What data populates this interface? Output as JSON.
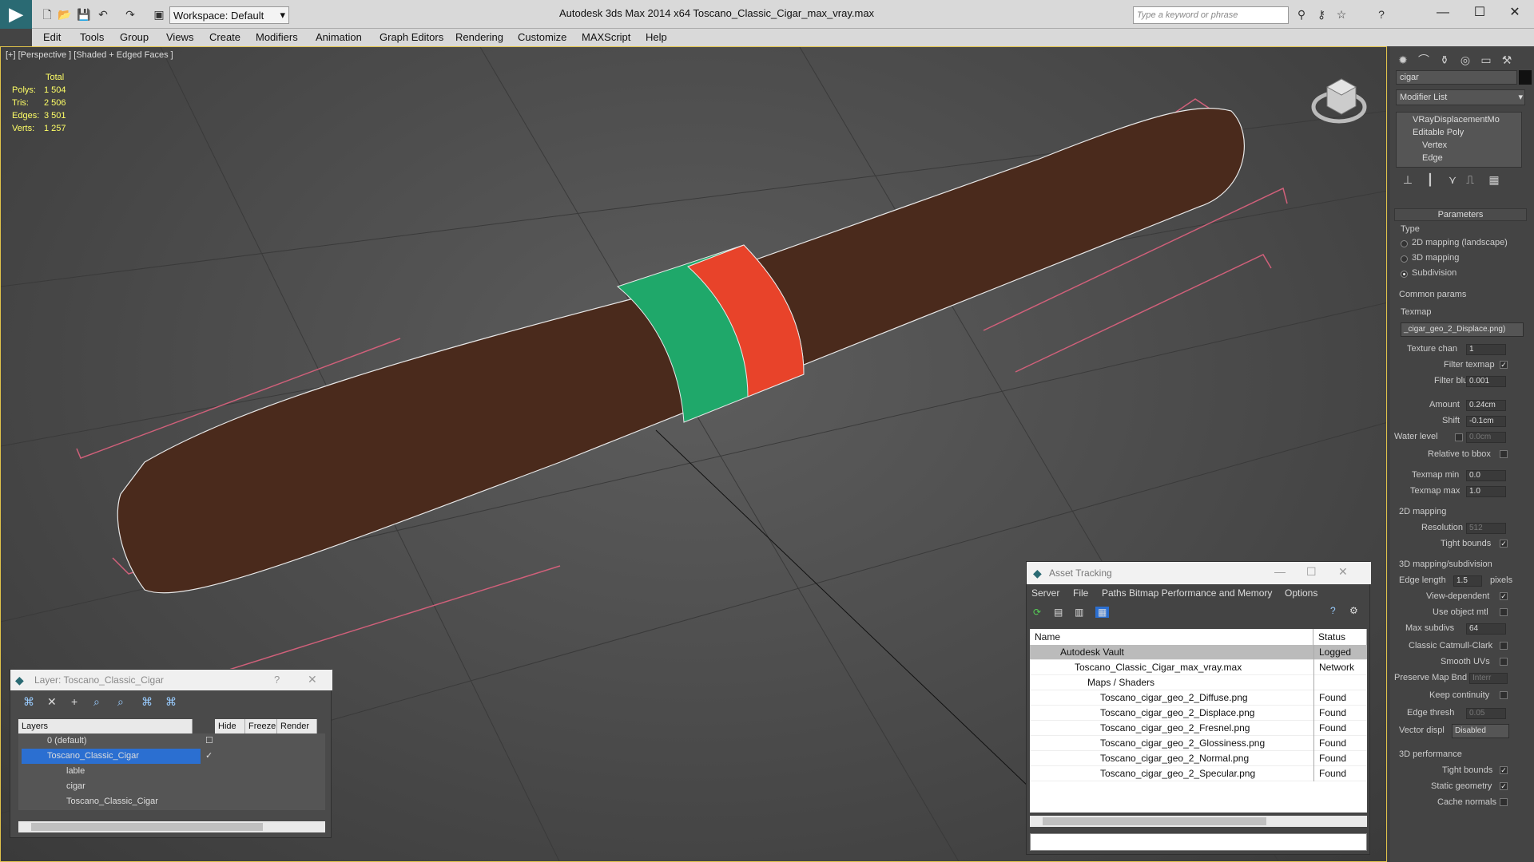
{
  "title_bar": {
    "app_title": "Autodesk 3ds Max  2014 x64      Toscano_Classic_Cigar_max_vray.max",
    "workspace": "Workspace: Default",
    "search_placeholder": "Type a keyword or phrase"
  },
  "menu": [
    "Edit",
    "Tools",
    "Group",
    "Views",
    "Create",
    "Modifiers",
    "Animation",
    "Graph Editors",
    "Rendering",
    "Customize",
    "MAXScript",
    "Help"
  ],
  "viewport": {
    "label": "[+] [Perspective ] [Shaded + Edged Faces ]",
    "stats_header": "Total",
    "stats": [
      {
        "k": "Polys:",
        "v": "1 504"
      },
      {
        "k": "Tris:",
        "v": "2 506"
      },
      {
        "k": "Edges:",
        "v": "3 501"
      },
      {
        "k": "Verts:",
        "v": "1 257"
      }
    ]
  },
  "command_panel": {
    "object_name": "cigar",
    "modifier_list": "Modifier List",
    "stack": [
      "VRayDisplacementMo",
      "Editable Poly",
      "Vertex",
      "Edge"
    ],
    "parameters_title": "Parameters",
    "type_label": "Type",
    "type_options": [
      "2D mapping (landscape)",
      "3D mapping",
      "Subdivision"
    ],
    "common_params": "Common params",
    "texmap_label": "Texmap",
    "texmap_value": "_cigar_geo_2_Displace.png)",
    "texture_chan_label": "Texture chan",
    "texture_chan": "1",
    "filter_texmap": "Filter texmap",
    "filter_blur_label": "Filter blur",
    "filter_blur": "0.001",
    "amount_label": "Amount",
    "amount": "0.24cm",
    "shift_label": "Shift",
    "shift": "-0.1cm",
    "water_level_label": "Water level",
    "water_level": "0.0cm",
    "relative_bbox": "Relative to bbox",
    "texmap_min_label": "Texmap min",
    "texmap_min": "0.0",
    "texmap_max_label": "Texmap max",
    "texmap_max": "1.0",
    "mapping2d": "2D mapping",
    "resolution_label": "Resolution",
    "resolution": "512",
    "tight_bounds": "Tight bounds",
    "mapping3d": "3D mapping/subdivision",
    "edge_length_label": "Edge length",
    "edge_length": "1.5",
    "pixels": "pixels",
    "view_dependent": "View-dependent",
    "use_object_mtl": "Use object mtl",
    "max_subdivs_label": "Max subdivs",
    "max_subdivs": "64",
    "classic_catmull": "Classic Catmull-Clark",
    "smooth_uvs": "Smooth UVs",
    "preserve_map_bnd_label": "Preserve Map Bnd",
    "preserve_map_bnd": "Interr",
    "keep_continuity": "Keep continuity",
    "edge_thresh_label": "Edge thresh",
    "edge_thresh": "0.05",
    "vector_displ_label": "Vector displ",
    "vector_displ": "Disabled",
    "perf_title": "3D performance",
    "perf_tight_bounds": "Tight bounds",
    "static_geometry": "Static geometry",
    "cache_normals": "Cache normals"
  },
  "layer_dialog": {
    "title": "Layer: Toscano_Classic_Cigar",
    "help": "?",
    "columns": [
      "Layers",
      "Hide",
      "Freeze",
      "Render"
    ],
    "rows": [
      "0 (default)",
      "Toscano_Classic_Cigar",
      "lable",
      "cigar",
      "Toscano_Classic_Cigar"
    ]
  },
  "asset_dialog": {
    "title": "Asset Tracking",
    "menu": [
      "Server",
      "File",
      "Paths",
      "Bitmap Performance and Memory",
      "Options"
    ],
    "columns": [
      "Name",
      "Status"
    ],
    "rows": [
      {
        "name": "Autodesk Vault",
        "status": "Logged Out"
      },
      {
        "name": "Toscano_Classic_Cigar_max_vray.max",
        "status": "Network Pat"
      },
      {
        "name": "Maps / Shaders",
        "status": ""
      },
      {
        "name": "Toscano_cigar_geo_2_Diffuse.png",
        "status": "Found"
      },
      {
        "name": "Toscano_cigar_geo_2_Displace.png",
        "status": "Found"
      },
      {
        "name": "Toscano_cigar_geo_2_Fresnel.png",
        "status": "Found"
      },
      {
        "name": "Toscano_cigar_geo_2_Glossiness.png",
        "status": "Found"
      },
      {
        "name": "Toscano_cigar_geo_2_Normal.png",
        "status": "Found"
      },
      {
        "name": "Toscano_cigar_geo_2_Specular.png",
        "status": "Found"
      }
    ]
  },
  "colors": {
    "cigar": "#4a2a1c",
    "band_green": "#1fa86a",
    "band_red": "#e8432a",
    "selection": "#2b6fd1",
    "bbox": "#d0607a"
  }
}
